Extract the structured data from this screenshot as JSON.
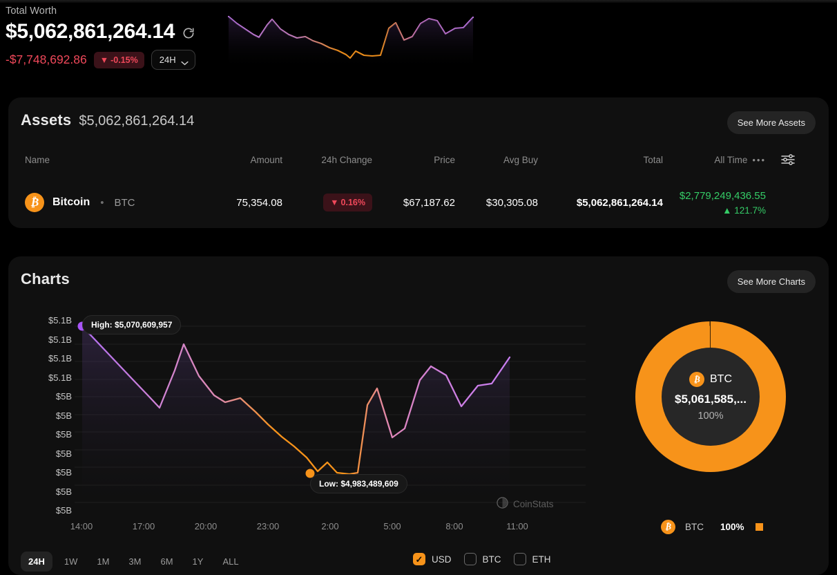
{
  "header": {
    "total_worth_label": "Total Worth",
    "total_worth_value": "$5,062,861,264.14",
    "refresh_icon": "refresh-icon",
    "change_absolute": "-$7,748,692.86",
    "change_percent": "-0.15%",
    "change_arrow": "▼",
    "range_selected": "24H",
    "negative_color": "#f0485a",
    "positive_color": "#35cc67",
    "accent_color": "#f7931a"
  },
  "assets": {
    "title": "Assets",
    "subtotal": "$5,062,861,264.14",
    "see_more_label": "See More Assets",
    "columns": [
      "Name",
      "Amount",
      "24h Change",
      "Price",
      "Avg Buy",
      "Total",
      "All Time"
    ],
    "alltime_dots": "•••",
    "filter_icon": "sliders-icon",
    "rows": [
      {
        "icon": "bitcoin-icon",
        "symbol": "₿",
        "name": "Bitcoin",
        "separator": "•",
        "ticker": "BTC",
        "amount": "75,354.08",
        "change_arrow": "▼",
        "change_pct": "0.16%",
        "price": "$67,187.62",
        "avg_buy": "$30,305.08",
        "total": "$5,062,861,264.14",
        "alltime_value": "$2,779,249,436.55",
        "alltime_arrow": "▲",
        "alltime_pct": "121.7%"
      }
    ]
  },
  "charts": {
    "title": "Charts",
    "see_more_label": "See More Charts",
    "watermark": "CoinStats",
    "watermark_icon": "coinstats-logo-icon",
    "tooltip_high": "High: $5,070,609,957",
    "tooltip_low": "Low: $4,983,489,609",
    "ranges": [
      "24H",
      "1W",
      "1M",
      "3M",
      "6M",
      "1Y",
      "ALL"
    ],
    "range_active": "24H",
    "currencies": [
      {
        "label": "USD",
        "checked": true
      },
      {
        "label": "BTC",
        "checked": false
      },
      {
        "label": "ETH",
        "checked": false
      }
    ],
    "donut": {
      "center_ticker": "BTC",
      "center_symbol": "₿",
      "center_value": "$5,061,585,...",
      "center_pct": "100%",
      "legend": [
        {
          "symbol": "₿",
          "ticker": "BTC",
          "pct": "100%",
          "color": "#f7931a"
        }
      ]
    }
  },
  "chart_data": {
    "type": "line",
    "title": "Total Worth 24H",
    "xlabel": "",
    "ylabel": "",
    "grid": true,
    "legend": false,
    "ytick_labels": [
      "$5.1B",
      "$5.1B",
      "$5.1B",
      "$5.1B",
      "$5B",
      "$5B",
      "$5B",
      "$5B",
      "$5B",
      "$5B",
      "$5B"
    ],
    "xtick_labels": [
      "14:00",
      "17:00",
      "20:00",
      "23:00",
      "2:00",
      "5:00",
      "8:00",
      "11:00"
    ],
    "ylim": [
      4975000000,
      5075000000
    ],
    "high": 5070609957,
    "low": 4983489609,
    "series": [
      {
        "name": "Total Worth",
        "x": [
          "13:30",
          "14:30",
          "15:30",
          "16:30",
          "17:00",
          "17:40",
          "18:20",
          "19:10",
          "20:00",
          "20:50",
          "21:40",
          "22:30",
          "23:20",
          "0:10",
          "1:00",
          "1:50",
          "2:10",
          "2:40",
          "3:30",
          "4:20",
          "4:50",
          "5:20",
          "6:00",
          "6:50",
          "7:40",
          "8:30",
          "9:20",
          "10:10",
          "11:00",
          "11:50",
          "12:40"
        ],
        "values": [
          5070609957,
          5057000000,
          5043000000,
          5031500000,
          5025000000,
          5047500000,
          5060000000,
          5044000000,
          5032000000,
          5026000000,
          5029500000,
          5018000000,
          5012000000,
          5003000000,
          4997000000,
          4990000000,
          4983489609,
          4991000000,
          4984500000,
          4984000000,
          4985500000,
          5034000000,
          5047500000,
          5018000000,
          5024000000,
          5048000000,
          5060500000,
          5057000000,
          5030500000,
          5040000000,
          5041500000
        ]
      }
    ],
    "line_gradient": [
      "#c77df0",
      "#f7931a"
    ],
    "high_marker_color": "#a855f7",
    "low_marker_color": "#f7931a"
  },
  "sparkline": {
    "values": [
      5070609957,
      5057000000,
      5043000000,
      5031500000,
      5025000000,
      5047500000,
      5060000000,
      5044000000,
      5032000000,
      5026000000,
      5029500000,
      5018000000,
      5012000000,
      5003000000,
      4997000000,
      4990000000,
      4983489609,
      4991000000,
      4984500000,
      4984000000,
      4985500000,
      5034000000,
      5047500000,
      5018000000,
      5024000000,
      5048000000,
      5060500000,
      5057000000,
      5030500000,
      5040000000,
      5041500000
    ]
  }
}
